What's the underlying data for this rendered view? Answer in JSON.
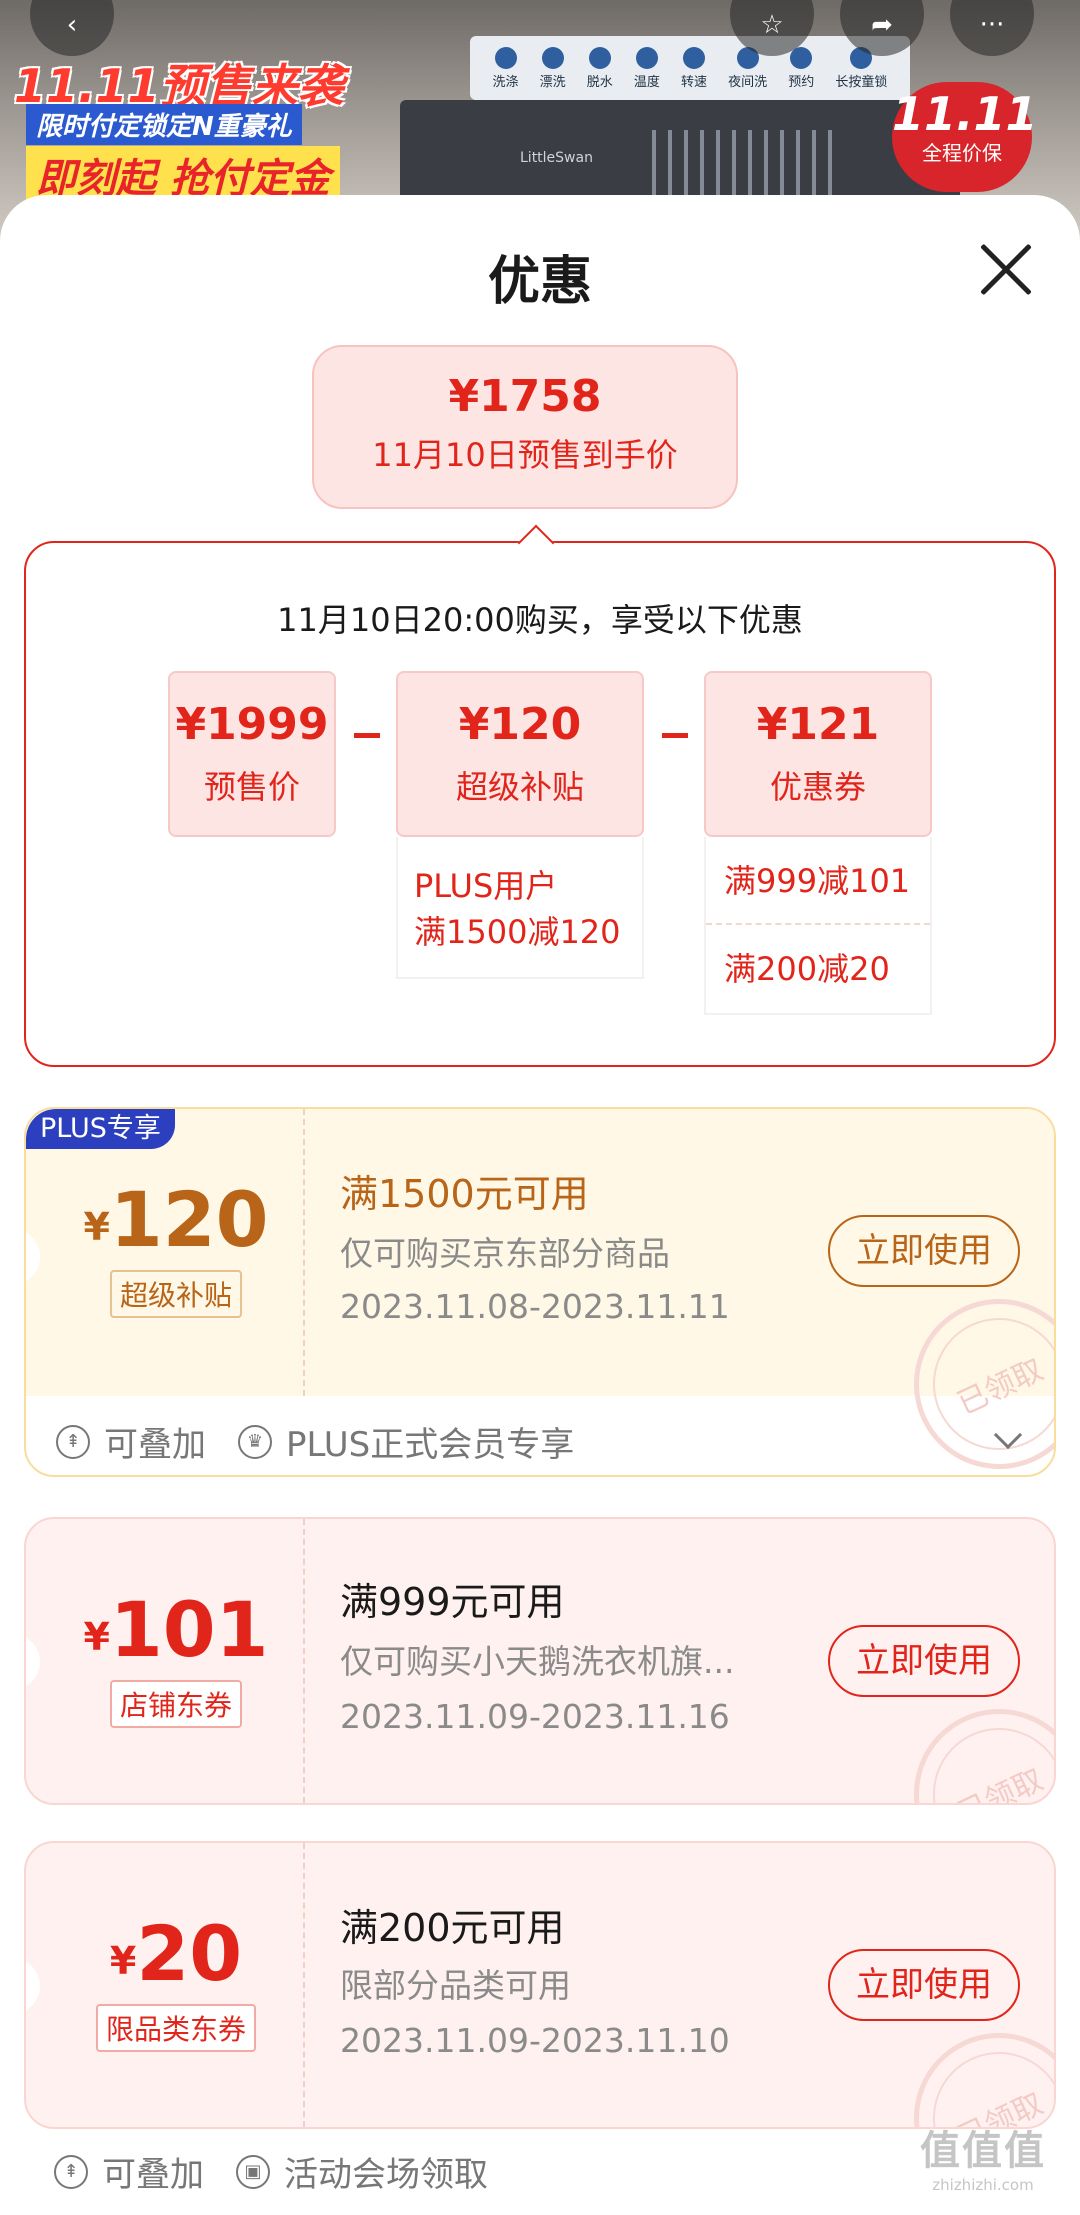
{
  "banner": {
    "promo_title": "11.11预售来袭",
    "promo_sub": "限时付定锁定N重豪礼",
    "promo_cta": "即刻起 抢付定金",
    "brand": "LittleSwan",
    "panel_labels": [
      "洗涤",
      "漂洗",
      "脱水",
      "温度",
      "转速",
      "夜间洗",
      "预约",
      "长按童锁"
    ],
    "badge_big": "11.11",
    "badge_small": "全程价保"
  },
  "sheet": {
    "title": "优惠"
  },
  "final_price": {
    "amount": "¥1758",
    "label": "11月10日预售到手价"
  },
  "breakdown": {
    "heading": "11月10日20:00购买，享受以下优惠",
    "presale": {
      "value": "¥1999",
      "label": "预售价"
    },
    "subsidy": {
      "value": "¥120",
      "label": "超级补贴",
      "detail_line1": "PLUS用户",
      "detail_line2": "满1500减120"
    },
    "coupon": {
      "value": "¥121",
      "label": "优惠券",
      "detail_1": "满999减101",
      "detail_2": "满200减20"
    }
  },
  "coupons": [
    {
      "badge": "PLUS专享",
      "yen": "¥",
      "amount": "120",
      "tag": "超级补贴",
      "condition": "满1500元可用",
      "scope": "仅可购买京东部分商品",
      "dates": "2023.11.08-2023.11.11",
      "button": "立即使用",
      "stamp": "已领取",
      "feature_1": "可叠加",
      "feature_2": "PLUS正式会员专享"
    },
    {
      "yen": "¥",
      "amount": "101",
      "tag": "店铺东券",
      "condition": "满999元可用",
      "scope": "仅可购买小天鹅洗衣机旗...",
      "dates": "2023.11.09-2023.11.16",
      "button": "立即使用",
      "stamp": "已领取"
    },
    {
      "yen": "¥",
      "amount": "20",
      "tag": "限品类东券",
      "condition": "满200元可用",
      "scope": "限部分品类可用",
      "dates": "2023.11.09-2023.11.10",
      "button": "立即使用",
      "stamp": "已领取",
      "feature_1": "可叠加",
      "feature_2": "活动会场领取"
    }
  ],
  "watermark": {
    "big": "值值值",
    "small": "zhizhizhi.com"
  },
  "colors": {
    "accent_red": "#e1251b",
    "plus_gold": "#b8651a",
    "plus_blue": "#2b3fbf"
  }
}
